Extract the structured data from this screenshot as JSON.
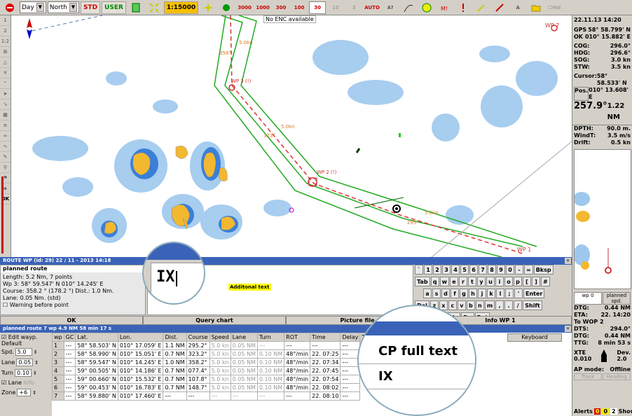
{
  "toolbar": {
    "mode": "Day",
    "orientation": "North",
    "std": "STD",
    "user": "USER",
    "scale": "1:15000",
    "depths": [
      "3000",
      "1000",
      "300",
      "100",
      "30",
      "10",
      "3"
    ],
    "auto": "AUTO",
    "right_text": "Hid"
  },
  "map": {
    "no_enc": "No ENC available",
    "wp_labels": [
      "WP 3 (!)",
      "WP 2 (!)",
      "WP 1",
      "WP 7"
    ],
    "course_labels": [
      "358°",
      "323°",
      "295°"
    ],
    "speed_labels": [
      "5.0kn",
      "5.0kn",
      "5.0kn"
    ]
  },
  "right_panel": {
    "datetime": "22.11.13 14:20",
    "gps_label": "GPS",
    "gps_lat": "58° 58.799' N",
    "ok_label": "OK",
    "gps_lon": "010° 15.882' E",
    "cog_label": "COG:",
    "cog": "296.0°",
    "hdg_label": "HDG:",
    "hdg": "296.6°",
    "sog_label": "SOG:",
    "sog": "3.0 kn",
    "stw_label": "STW:",
    "stw": "3.5 kn",
    "cursor_label": "Cursor:",
    "cursor_lat": "58° 58.533' N",
    "pos_label": "Pos.",
    "cursor_lon": "010° 13.608' E",
    "bearing": "257.9°",
    "range": "1.22 NM",
    "dpth_label": "DPTH:",
    "dpth": "90.0 m.",
    "wind_label": "WindT:",
    "wind": "3.5 m/s",
    "drift_label": "Drift:",
    "drift": "0.5 kn",
    "wp_tab": "wp 0",
    "spd_tab": "planned spd.",
    "dtg_label": "DTG:",
    "dtg": "0.44 NM",
    "eta_label": "ETA:",
    "eta": "22. 14:20",
    "towop": "To WOP 2",
    "dts_label": "DTS:",
    "dts": "294.0°",
    "dtg2_label": "DTG:",
    "dtg2": "0.44 NM",
    "ttg_label": "TTG:",
    "ttg": "8 min 53 s",
    "xte_label": "XTE",
    "xte": "0.010",
    "dev_label": "Dev.",
    "dev": "2.0",
    "ap_mode_label": "AP mode:",
    "ap_mode": "Offline",
    "track_btn": "Track",
    "heading_btn": "Heading",
    "alerts_label": "Alerts",
    "alert_counts": [
      "0",
      "0",
      "2"
    ],
    "show": "Show"
  },
  "wp_panel": {
    "title": "ROUTE WP (id: 29) 22 / 11 - 2013 14:18",
    "route_name": "planned route",
    "info_lines": [
      "Length: 5.2 Nm,  7 points",
      "Wp 3:  58° 59.547' N  010° 14.245' E",
      "Course: 358.2 ° (178.2 °)  Dist.: 1.0 Nm.",
      "Lane: 0.05 Nm. (std)"
    ],
    "warning": "Warning before point",
    "text_value": "IX",
    "additional": "Additonal text",
    "buttons": [
      "OK",
      "Query chart",
      "Picture file",
      "Info WP 1"
    ],
    "keys_row1": [
      "`",
      "1",
      "2",
      "3",
      "4",
      "5",
      "6",
      "7",
      "8",
      "9",
      "0",
      "-",
      "=",
      "Bksp"
    ],
    "keys_row2": [
      "Tab",
      "q",
      "w",
      "e",
      "r",
      "t",
      "y",
      "u",
      "i",
      "o",
      "p",
      "[",
      "]",
      "#"
    ],
    "keys_row3": [
      "a",
      "s",
      "d",
      "f",
      "g",
      "h",
      "j",
      "k",
      "l",
      ";",
      "'",
      "Enter"
    ],
    "keys_row4": [
      "Del",
      "z",
      "x",
      "c",
      "v",
      "b",
      "n",
      "m",
      ",",
      ".",
      "/",
      "Shift"
    ],
    "keys_row5": [
      "Lock",
      "Lft",
      "Up",
      "Dn",
      "Rgt"
    ]
  },
  "route_table": {
    "title": "planned route  7 wp   4.9 NM   58 min 17 s",
    "edit_ways": "Edit wayp.",
    "default": "Default",
    "spd_label": "Spd.",
    "spd": "5.0",
    "lane_label": "Lane",
    "lane": "0.05",
    "turn_label": "Turn",
    "turn": "0.10",
    "lane_chk": "Lane",
    "info_chk": "Info",
    "zone_label": "Zone",
    "zone": "+6",
    "headers": [
      "wp",
      "GC",
      "Lat.",
      "Lon.",
      "Dist.",
      "Course",
      "Speed",
      "Lane",
      "Turn",
      "ROT",
      "Time",
      "Delay",
      "Te"
    ],
    "keyboard_label": "Keyboard",
    "rows": [
      [
        "1",
        "---",
        "58° 58.503' N",
        "010° 17.059' E",
        "1.1 NM",
        "295.2°",
        "5.0 kn",
        "0.05 NM",
        "---",
        "---",
        "---",
        "---"
      ],
      [
        "2",
        "---",
        "58° 58.990' N",
        "010° 15.051' E",
        "0.7 NM",
        "323.2°",
        "5.0 kn",
        "0.05 NM",
        "0.10 NM",
        "48°/min",
        "22. 07:25",
        "---"
      ],
      [
        "3",
        "---",
        "58° 59.547' N",
        "010° 14.245' E",
        "1.0 NM",
        "358.2°",
        "5.0 kn",
        "0.05 NM",
        "0.10 NM",
        "48°/min",
        "22. 07:34",
        "---"
      ],
      [
        "4",
        "---",
        "59° 00.505' N",
        "010° 14.186' E",
        "0.7 NM",
        "077.4°",
        "5.0 kn",
        "0.05 NM",
        "0.10 NM",
        "48°/min",
        "22. 07:45",
        "---"
      ],
      [
        "5",
        "---",
        "59° 00.660' N",
        "010° 15.532' E",
        "0.7 NM",
        "107.8°",
        "5.0 kn",
        "0.05 NM",
        "0.10 NM",
        "48°/min",
        "22. 07:54",
        "---"
      ],
      [
        "6",
        "---",
        "59° 00.453' N",
        "010° 16.783' E",
        "0.7 NM",
        "148.7°",
        "5.0 kn",
        "0.05 NM",
        "0.10 NM",
        "48°/min",
        "22. 08:02",
        "---"
      ],
      [
        "7",
        "---",
        "58° 59.880' N",
        "010° 17.460' E",
        "---",
        "---",
        "---",
        "---",
        "---",
        "---",
        "22. 08:10",
        "---"
      ]
    ]
  },
  "zoom": {
    "ix_top": "IX",
    "cp_full_text": "CP full text",
    "ix_bottom": "IX"
  }
}
